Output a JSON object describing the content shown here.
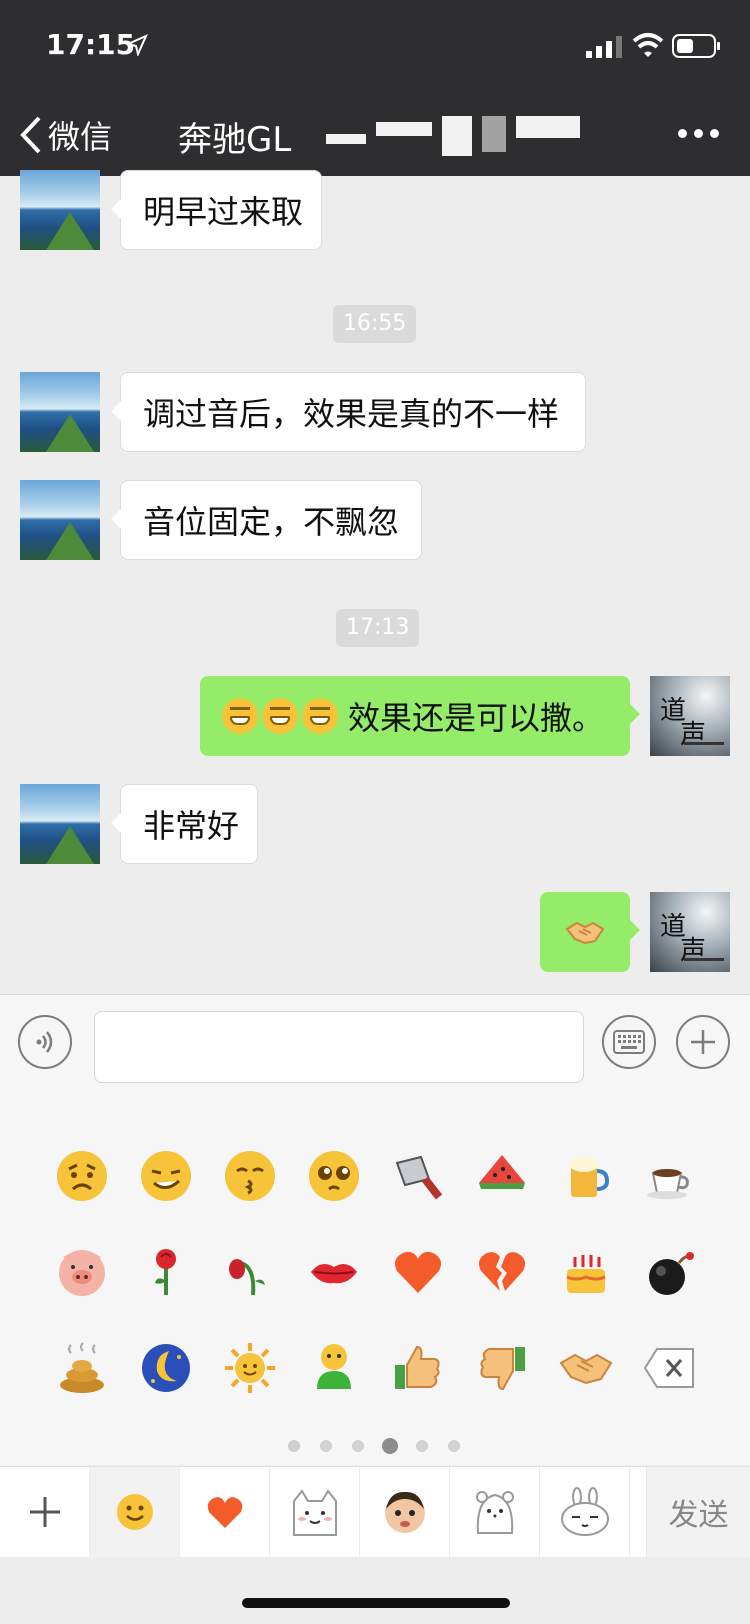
{
  "status_bar": {
    "time": "17:15"
  },
  "nav": {
    "back_label": "微信",
    "title": "奔驰GL"
  },
  "messages": [
    {
      "side": "left",
      "text": "明早过来取"
    },
    {
      "timestamp": "16:55"
    },
    {
      "side": "left",
      "text": "调过音后，效果是真的不一样"
    },
    {
      "side": "left",
      "text": "音位固定，不飘忽"
    },
    {
      "timestamp": "17:13"
    },
    {
      "side": "right",
      "text": "效果还是可以撒。",
      "leading_emoji_count": 3
    },
    {
      "side": "left",
      "text": "非常好"
    },
    {
      "side": "right",
      "emoji": "handshake-icon"
    }
  ],
  "emoji_panel": {
    "rows": [
      [
        "sad-face-icon",
        "smirk-face-icon",
        "kiss-face-icon",
        "teary-eyes-face-icon",
        "cleaver-knife-icon",
        "watermelon-icon",
        "beer-mug-icon",
        "coffee-cup-icon"
      ],
      [
        "pig-face-icon",
        "rose-icon",
        "wilted-rose-icon",
        "lips-icon",
        "heart-icon",
        "broken-heart-icon",
        "birthday-cake-icon",
        "bomb-icon"
      ],
      [
        "poop-icon",
        "moon-icon",
        "sun-icon",
        "hug-figure-icon",
        "thumbs-up-icon",
        "thumbs-down-icon",
        "handshake-icon",
        "delete-key-icon"
      ]
    ],
    "page_count": 6,
    "active_page": 4
  },
  "sticker_tabs": [
    "add-sticker-icon",
    "smiley-tab-icon",
    "heart-tab-icon",
    "cat-sticker-icon",
    "child-sticker-icon",
    "bear-sticker-icon",
    "rabbit-sticker-icon"
  ],
  "send_label": "发送",
  "colors": {
    "nav_bg": "#2e2e30",
    "chat_bg": "#ededed",
    "out_bubble": "#95ec69",
    "in_bubble": "#ffffff"
  }
}
